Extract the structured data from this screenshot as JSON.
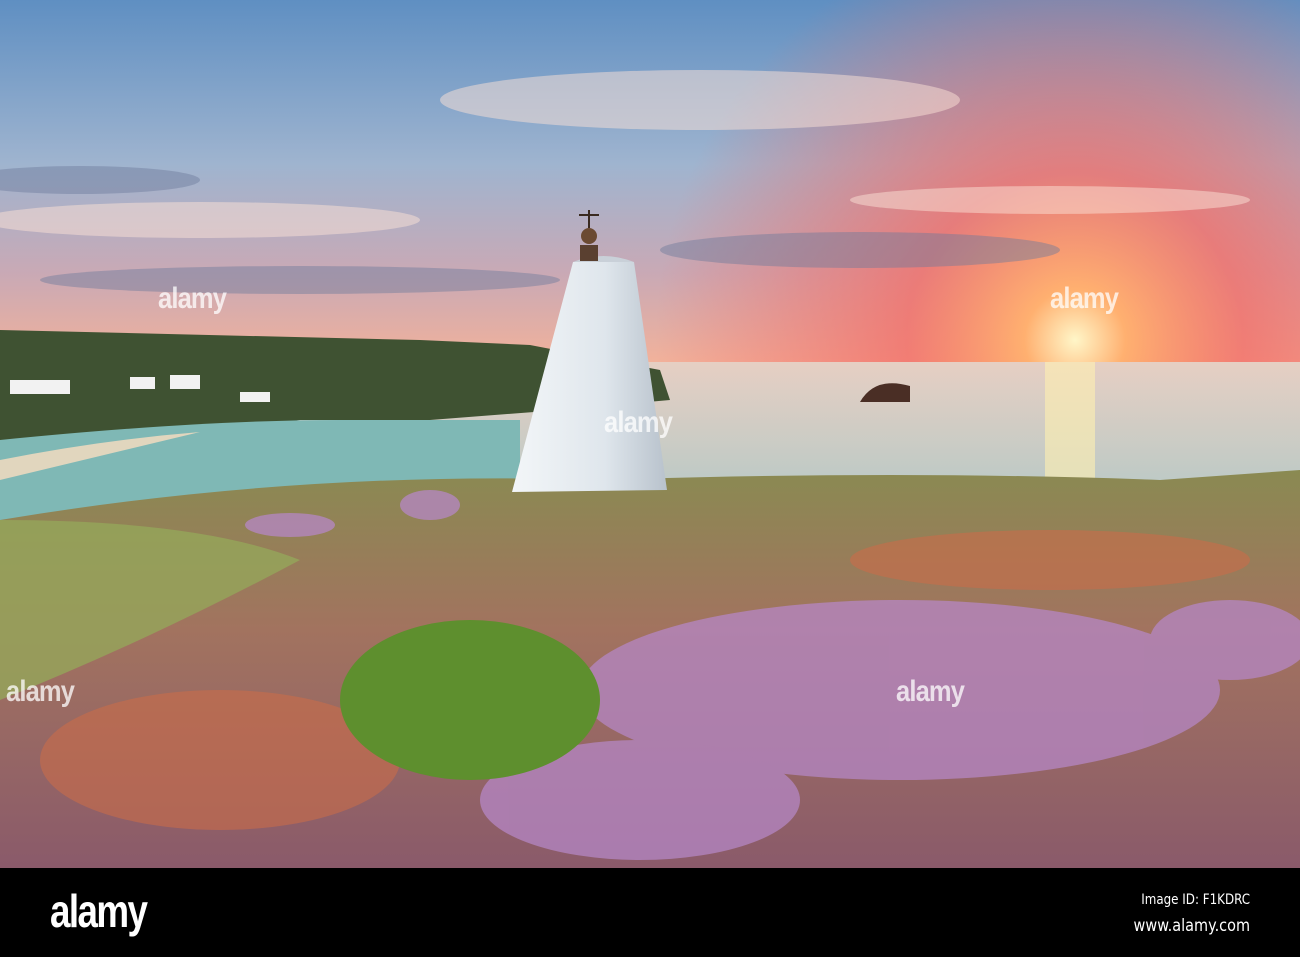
{
  "photo": {
    "colors": {
      "sky_top": "#6f9cc9",
      "sky_glow": "#f4866a",
      "sun": "#fff3c0",
      "sea": "#c9d6d0",
      "bay": "#7fb8b5",
      "heather": "#b07fb8",
      "grass": "#7d9a45",
      "beacon": "#e9eef2"
    }
  },
  "watermark": {
    "text": "alamy"
  },
  "footer": {
    "logo": "alamy",
    "image_id": "Image ID: F1KDRC",
    "site": "www.alamy.com"
  }
}
